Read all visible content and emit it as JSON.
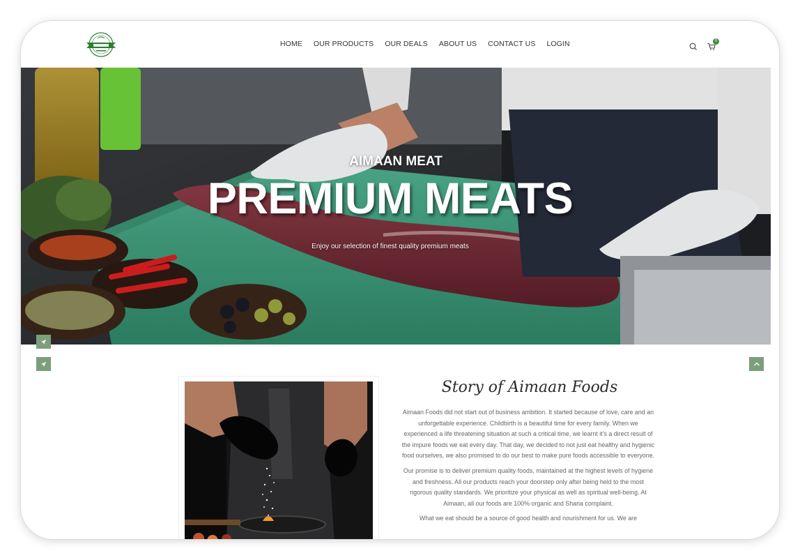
{
  "header": {
    "logo_alt": "Aimaan Foods",
    "nav": [
      {
        "label": "HOME"
      },
      {
        "label": "OUR PRODUCTS"
      },
      {
        "label": "OUR DEALS"
      },
      {
        "label": "ABOUT US"
      },
      {
        "label": "CONTACT US"
      },
      {
        "label": "LOGIN"
      }
    ],
    "cart_count": "0",
    "icons": [
      "search-icon",
      "cart-icon"
    ]
  },
  "hero": {
    "eyebrow": "AIMAAN MEAT",
    "title": "PREMIUM MEATS",
    "subtitle": "Enjoy our selection of finest quality premium meats"
  },
  "story": {
    "title": "Story of Aimaan Foods",
    "paragraphs": [
      "Aimaan Foods did not start out of business ambition. It started because of love, care and an unforgettable experience. Childbirth is a beautiful time for every family. When we experienced a life threatening situation at such a critical time, we learnt it’s a direct result of the impure foods we eat every day. That day, we decided to not just eat healthy and hygienic food ourselves, we also promised to do our best to make pure foods accessible to everyone.",
      "Our promise is to deliver premium quality foods, maintained at the highest levels of hygiene and freshness. All our products reach your doorstep only after being held to the most rigorous quality standards. We prioritize your physical as well as spiritual well-being. At Aimaan, all our foods are 100% organic and Sharia complaint.",
      "What we eat should be a source of good health and nourishment for us. We are"
    ]
  },
  "colors": {
    "accent_green": "#3e8b3e",
    "button_green": "#7d9e7d",
    "board_green": "#3f9a7c"
  }
}
